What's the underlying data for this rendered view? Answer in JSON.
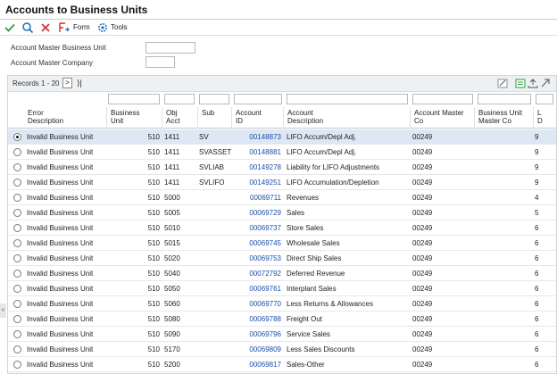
{
  "window": {
    "title": "Accounts to Business Units"
  },
  "toolbar": {
    "form_label": "Form",
    "tools_label": "Tools"
  },
  "filters": {
    "business_unit_label": "Account Master Business Unit",
    "business_unit_value": "",
    "company_label": "Account Master Company",
    "company_value": ""
  },
  "grid": {
    "records_label": "Records 1 - 20",
    "next_glyph": ">",
    "last_glyph": "⟩|",
    "columns": [
      "Error\nDescription",
      "Business\nUnit",
      "Obj\nAcct",
      "Sub",
      "Account\nID",
      "Account\nDescription",
      "Account Master\nCo",
      "Business Unit\nMaster Co",
      "L\nD"
    ],
    "rows": [
      {
        "err": "Invalid Business Unit",
        "bu": "510",
        "obj": "1411",
        "sub": "SV",
        "id": "00148873",
        "desc": "LIFO Accum/Depl Adj.",
        "co": "00249",
        "ld": "9",
        "selected": true
      },
      {
        "err": "Invalid Business Unit",
        "bu": "510",
        "obj": "1411",
        "sub": "SVASSET",
        "id": "00148881",
        "desc": "LIFO Accum/Depl Adj.",
        "co": "00249",
        "ld": "9",
        "selected": false
      },
      {
        "err": "Invalid Business Unit",
        "bu": "510",
        "obj": "1411",
        "sub": "SVLIAB",
        "id": "00149278",
        "desc": "Liability for LIFO Adjustments",
        "co": "00249",
        "ld": "9",
        "selected": false
      },
      {
        "err": "Invalid Business Unit",
        "bu": "510",
        "obj": "1411",
        "sub": "SVLIFO",
        "id": "00149251",
        "desc": "LIFO Accumulation/Depletion",
        "co": "00249",
        "ld": "9",
        "selected": false
      },
      {
        "err": "Invalid Business Unit",
        "bu": "510",
        "obj": "5000",
        "sub": "",
        "id": "00069711",
        "desc": "Revenues",
        "co": "00249",
        "ld": "4",
        "selected": false
      },
      {
        "err": "Invalid Business Unit",
        "bu": "510",
        "obj": "5005",
        "sub": "",
        "id": "00069729",
        "desc": "Sales",
        "co": "00249",
        "ld": "5",
        "selected": false
      },
      {
        "err": "Invalid Business Unit",
        "bu": "510",
        "obj": "5010",
        "sub": "",
        "id": "00069737",
        "desc": "Store Sales",
        "co": "00249",
        "ld": "6",
        "selected": false
      },
      {
        "err": "Invalid Business Unit",
        "bu": "510",
        "obj": "5015",
        "sub": "",
        "id": "00069745",
        "desc": "Wholesale Sales",
        "co": "00249",
        "ld": "6",
        "selected": false
      },
      {
        "err": "Invalid Business Unit",
        "bu": "510",
        "obj": "5020",
        "sub": "",
        "id": "00069753",
        "desc": "Direct Ship Sales",
        "co": "00249",
        "ld": "6",
        "selected": false
      },
      {
        "err": "Invalid Business Unit",
        "bu": "510",
        "obj": "5040",
        "sub": "",
        "id": "00072792",
        "desc": "Deferred Revenue",
        "co": "00249",
        "ld": "6",
        "selected": false
      },
      {
        "err": "Invalid Business Unit",
        "bu": "510",
        "obj": "5050",
        "sub": "",
        "id": "00069761",
        "desc": "Interplant Sales",
        "co": "00249",
        "ld": "6",
        "selected": false
      },
      {
        "err": "Invalid Business Unit",
        "bu": "510",
        "obj": "5060",
        "sub": "",
        "id": "00069770",
        "desc": "Less Returns & Allowances",
        "co": "00249",
        "ld": "6",
        "selected": false
      },
      {
        "err": "Invalid Business Unit",
        "bu": "510",
        "obj": "5080",
        "sub": "",
        "id": "00069788",
        "desc": "Freight Out",
        "co": "00249",
        "ld": "6",
        "selected": false
      },
      {
        "err": "Invalid Business Unit",
        "bu": "510",
        "obj": "5090",
        "sub": "",
        "id": "00069796",
        "desc": "Service Sales",
        "co": "00249",
        "ld": "6",
        "selected": false
      },
      {
        "err": "Invalid Business Unit",
        "bu": "510",
        "obj": "5170",
        "sub": "",
        "id": "00069809",
        "desc": "Less Sales Discounts",
        "co": "00249",
        "ld": "6",
        "selected": false
      },
      {
        "err": "Invalid Business Unit",
        "bu": "510",
        "obj": "5200",
        "sub": "",
        "id": "00069817",
        "desc": "Sales-Other",
        "co": "00249",
        "ld": "6",
        "selected": false
      }
    ]
  },
  "colors": {
    "accent_green": "#2e9a3a",
    "link_blue": "#1b4fa8",
    "cancel_red": "#d22b2b",
    "selected_row": "#dde8f4"
  }
}
